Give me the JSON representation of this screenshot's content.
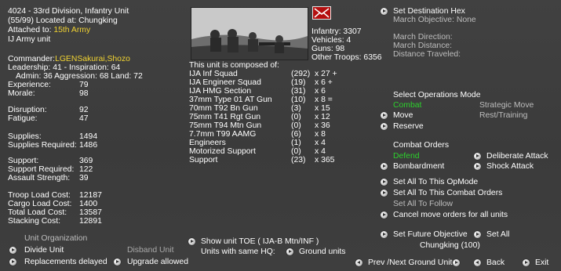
{
  "header": {
    "unit_title": "4024 - 33rd Division, Infantry Unit",
    "location": "(55/99) Located at: Chungking",
    "attached_label": "Attached to:",
    "attached_value": "15th Army",
    "unit_type": "IJ Army unit"
  },
  "commander": {
    "label": "Commander:",
    "value": "LGENSakurai,Shozo",
    "leadership": "Leadership: 41 - Inspiration: 64",
    "ratings": "Admin: 36  Aggression: 68  Land: 72"
  },
  "stats": [
    {
      "label": "Experience:",
      "value": "79"
    },
    {
      "label": "Morale:",
      "value": "98"
    },
    {
      "label": "Disruption:",
      "value": "92"
    },
    {
      "label": "Fatigue:",
      "value": "47"
    },
    {
      "label": "Supplies:",
      "value": "1494"
    },
    {
      "label": "Supplies Required:",
      "value": "1486"
    },
    {
      "label": "Support:",
      "value": "369"
    },
    {
      "label": "Support Required:",
      "value": "122"
    },
    {
      "label": "Assault Strength:",
      "value": "39"
    },
    {
      "label": "Troop Load Cost:",
      "value": "12187"
    },
    {
      "label": "Cargo Load Cost:",
      "value": "1400"
    },
    {
      "label": "Total Load Cost:",
      "value": "13587"
    },
    {
      "label": "Stacking Cost:",
      "value": "12891"
    }
  ],
  "unit_org": {
    "title": "Unit Organization",
    "divide": "Divide Unit",
    "disband": "Disband Unit",
    "replacements": "Replacements delayed",
    "upgrade": "Upgrade allowed"
  },
  "troops": [
    "Infantry: 3307",
    "Vehicles: 4",
    "Guns: 98",
    "Other Troops: 6356"
  ],
  "composition": {
    "title": "This unit is composed of:",
    "rows": [
      {
        "name": "IJA Inf Squad",
        "count": "(292)",
        "mult": "x 27 +"
      },
      {
        "name": "IJA Engineer Squad",
        "count": "(19)",
        "mult": "x 6 +"
      },
      {
        "name": "IJA HMG Section",
        "count": "(31)",
        "mult": "x 6"
      },
      {
        "name": "37mm Type 01 AT Gun",
        "count": "(10)",
        "mult": "x 8 ="
      },
      {
        "name": "70mm T92 Bn Gun",
        "count": "(3)",
        "mult": "x 15"
      },
      {
        "name": "75mm T41 Rgt Gun",
        "count": "(0)",
        "mult": "x 12"
      },
      {
        "name": "75mm T94 Mtn Gun",
        "count": "(0)",
        "mult": "x 36"
      },
      {
        "name": "7.7mm T99 AAMG",
        "count": "(6)",
        "mult": "x 8"
      },
      {
        "name": "Engineers",
        "count": "(1)",
        "mult": "x 4"
      },
      {
        "name": "Motorized Support",
        "count": "(0)",
        "mult": "x 4"
      },
      {
        "name": "Support",
        "count": "(23)",
        "mult": "x 365"
      }
    ]
  },
  "toe": {
    "show": "Show unit TOE ( IJA-B Mtn/INF )",
    "same_hq": "Units with same HQ:",
    "ground": "Ground units"
  },
  "march": {
    "set_dest": "Set Destination Hex",
    "objective": "March Objective: None",
    "direction": "March Direction:",
    "distance": "March Distance:",
    "traveled": "Distance Traveled:"
  },
  "ops_mode": {
    "title": "Select Operations Mode",
    "combat": "Combat",
    "strategic": "Strategic Move",
    "move": "Move",
    "rest": "Rest/Training",
    "reserve": "Reserve"
  },
  "combat_orders": {
    "title": "Combat Orders",
    "defend": "Defend",
    "deliberate": "Deliberate Attack",
    "bombardment": "Bombardment",
    "shock": "Shock Attack"
  },
  "actions": {
    "set_all_opmode": "Set All To This OpMode",
    "set_all_combat": "Set All To This Combat Orders",
    "set_all_follow": "Set All To Follow",
    "cancel_move": "Cancel move orders for all units",
    "future_obj": "Set Future Objective",
    "set_all": "Set All",
    "chungking": "Chungking (100)"
  },
  "footer": {
    "prev_next": "Prev /Next Ground Unit",
    "back": "Back",
    "exit": "Exit"
  },
  "colors": {
    "background": "#3d3d3d",
    "highlight_yellow": "#f0d232",
    "active_green": "#2cd12c",
    "mail_red": "#b40f0f"
  },
  "icons": [
    "mail-icon",
    "unit-photo",
    "arrow-button-icon"
  ]
}
